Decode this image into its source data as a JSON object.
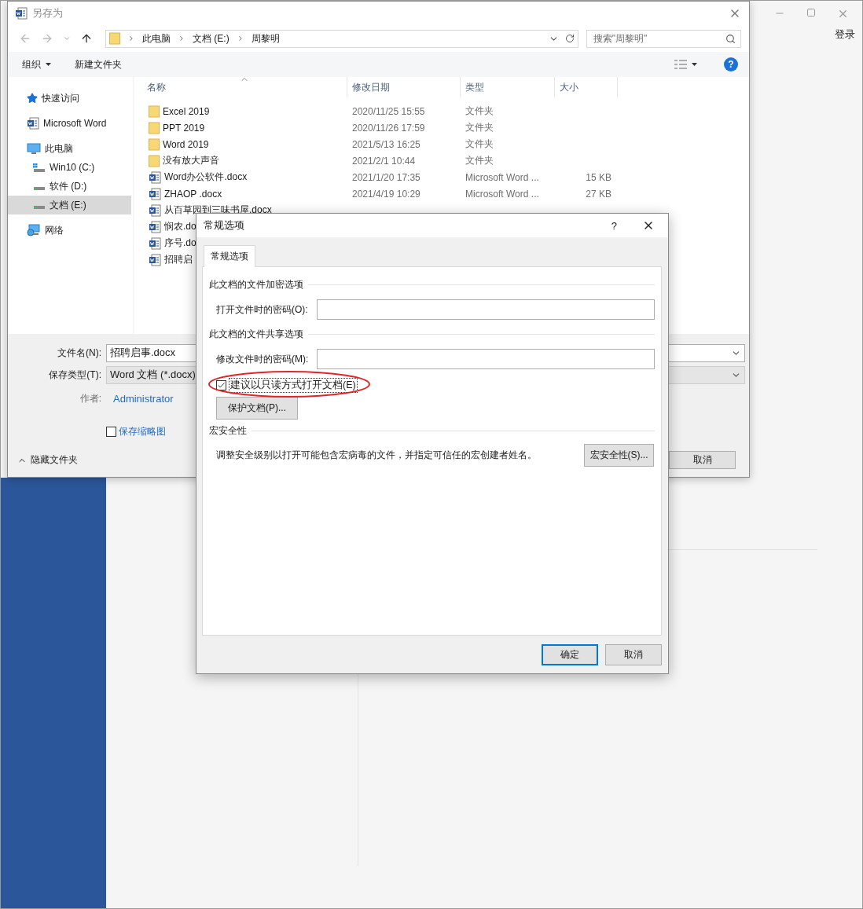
{
  "word_window": {
    "sign_in": "登录"
  },
  "save_dialog": {
    "title": "另存为",
    "breadcrumb": [
      "此电脑",
      "文档 (E:)",
      "周黎明"
    ],
    "search": {
      "placeholder": "搜索\"周黎明\""
    },
    "toolbar": {
      "organize": "组织",
      "new_folder": "新建文件夹",
      "help": "?"
    },
    "sidebar": {
      "items": [
        {
          "label": "快速访问",
          "kind": "star",
          "selected": false
        },
        {
          "label": "Microsoft Word",
          "kind": "word",
          "selected": false
        },
        {
          "label": "此电脑",
          "kind": "pc",
          "selected": false,
          "children": [
            {
              "label": "Win10 (C:)",
              "kind": "system-drive",
              "selected": false
            },
            {
              "label": "软件 (D:)",
              "kind": "drive",
              "selected": false
            },
            {
              "label": "文档 (E:)",
              "kind": "drive",
              "selected": true
            }
          ]
        },
        {
          "label": "网络",
          "kind": "network",
          "selected": false
        }
      ]
    },
    "columns": [
      "名称",
      "修改日期",
      "类型",
      "大小"
    ],
    "rows": [
      {
        "kind": "folder",
        "name": "Excel 2019",
        "date": "2020/11/25 15:55",
        "type": "文件夹"
      },
      {
        "kind": "folder",
        "name": "PPT 2019",
        "date": "2020/11/26 17:59",
        "type": "文件夹"
      },
      {
        "kind": "folder",
        "name": "Word 2019",
        "date": "2021/5/13 16:25",
        "type": "文件夹"
      },
      {
        "kind": "folder",
        "name": "没有放大声音",
        "date": "2021/2/1 10:44",
        "type": "文件夹"
      },
      {
        "kind": "doc",
        "name": "Word办公软件.docx",
        "date": "2021/1/20 17:35",
        "type": "Microsoft Word ...",
        "size": "15 KB"
      },
      {
        "kind": "doc",
        "name": "ZHAOP .docx",
        "date": "2021/4/19 10:29",
        "type": "Microsoft Word ...",
        "size": "27 KB"
      },
      {
        "kind": "doc",
        "name": "从百草园到三味书屋.docx"
      },
      {
        "kind": "doc",
        "name": "悯农.do"
      },
      {
        "kind": "doc",
        "name": "序号.do"
      },
      {
        "kind": "doc",
        "name": "招聘启"
      }
    ],
    "file_name": {
      "label": "文件名(N):",
      "value": "招聘启事.docx"
    },
    "save_type": {
      "label": "保存类型(T):",
      "value": "Word 文档 (*.docx)"
    },
    "author": {
      "label": "作者:",
      "value": "Administrator"
    },
    "thumbnail": {
      "label": "保存缩略图",
      "checked": false
    },
    "hide_folders": "隐藏文件夹",
    "cancel": "取消"
  },
  "options_dialog": {
    "title": "常规选项",
    "help": "?",
    "tabs": [
      {
        "label": "常规选项",
        "selected": true
      }
    ],
    "encryption": {
      "heading": "此文档的文件加密选项",
      "label": "打开文件时的密码(O):"
    },
    "sharing": {
      "heading": "此文档的文件共享选项",
      "label": "修改文件时的密码(M):"
    },
    "read_only": {
      "label": "建议以只读方式打开文档(E)",
      "checked": true,
      "highlighted": true
    },
    "protect_button": "保护文档(P)...",
    "macro": {
      "heading": "宏安全性",
      "description": "调整安全级别以打开可能包含宏病毒的文件，并指定可信任的宏创建者姓名。",
      "button": "宏安全性(S)..."
    },
    "buttons": [
      {
        "label": "确定",
        "default": true
      },
      {
        "label": "取消",
        "default": false
      }
    ]
  }
}
